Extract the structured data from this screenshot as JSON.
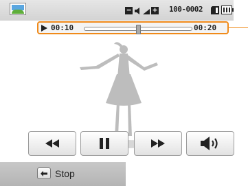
{
  "top_bar": {
    "file_number": "100-0002",
    "icons": {
      "thumbnail": "landscape-thumbnail-icon",
      "exposure_minus": "minus-icon",
      "volume_small": "speaker-small-icon",
      "exposure_plus": "plus-icon",
      "memory_card": "memory-card-icon",
      "battery": "battery-full-icon"
    },
    "minus_glyph": "−",
    "plus_glyph": "+"
  },
  "playback": {
    "current_time": "00:10",
    "total_time": "00:20",
    "progress": 0.5,
    "play_icon": "play-icon"
  },
  "controls": [
    {
      "name": "rewind",
      "icon": "rewind-icon"
    },
    {
      "name": "pause",
      "icon": "pause-icon"
    },
    {
      "name": "fast-forward",
      "icon": "fast-forward-icon"
    },
    {
      "name": "volume",
      "icon": "volume-icon"
    }
  ],
  "bottom_bar": {
    "stop_label": "Stop",
    "stop_icon": "back-arrow-icon"
  },
  "colors": {
    "highlight": "#f08a1a",
    "icon": "#222222"
  }
}
